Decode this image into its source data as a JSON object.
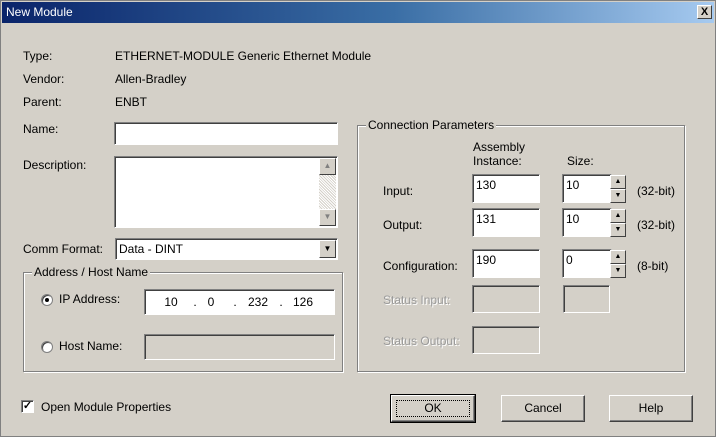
{
  "window": {
    "title": "New Module",
    "close_label": "X"
  },
  "info": {
    "type_label": "Type:",
    "type_value": "ETHERNET-MODULE Generic Ethernet Module",
    "vendor_label": "Vendor:",
    "vendor_value": "Allen-Bradley",
    "parent_label": "Parent:",
    "parent_value": "ENBT"
  },
  "name": {
    "label": "Name:",
    "value": ""
  },
  "description": {
    "label": "Description:",
    "value": ""
  },
  "comm_format": {
    "label": "Comm Format:",
    "value": "Data - DINT"
  },
  "address": {
    "group_title": "Address / Host Name",
    "ip_label": "IP Address:",
    "ip_octets": [
      "10",
      "0",
      "232",
      "126"
    ],
    "host_label": "Host Name:",
    "host_value": "",
    "selected": "ip"
  },
  "connection": {
    "group_title": "Connection Parameters",
    "col_instance": "Assembly\nInstance:",
    "col_instance_l1": "Assembly",
    "col_instance_l2": "Instance:",
    "col_size": "Size:",
    "rows": [
      {
        "label": "Input:",
        "instance": "130",
        "size": "10",
        "unit": "(32-bit)"
      },
      {
        "label": "Output:",
        "instance": "131",
        "size": "10",
        "unit": "(32-bit)"
      },
      {
        "label": "Configuration:",
        "instance": "190",
        "size": "0",
        "unit": "(8-bit)"
      }
    ],
    "status_input_label": "Status Input:",
    "status_output_label": "Status Output:"
  },
  "footer": {
    "open_props_label": "Open Module Properties",
    "open_props_checked": true,
    "ok_label": "OK",
    "cancel_label": "Cancel",
    "help_label": "Help"
  }
}
